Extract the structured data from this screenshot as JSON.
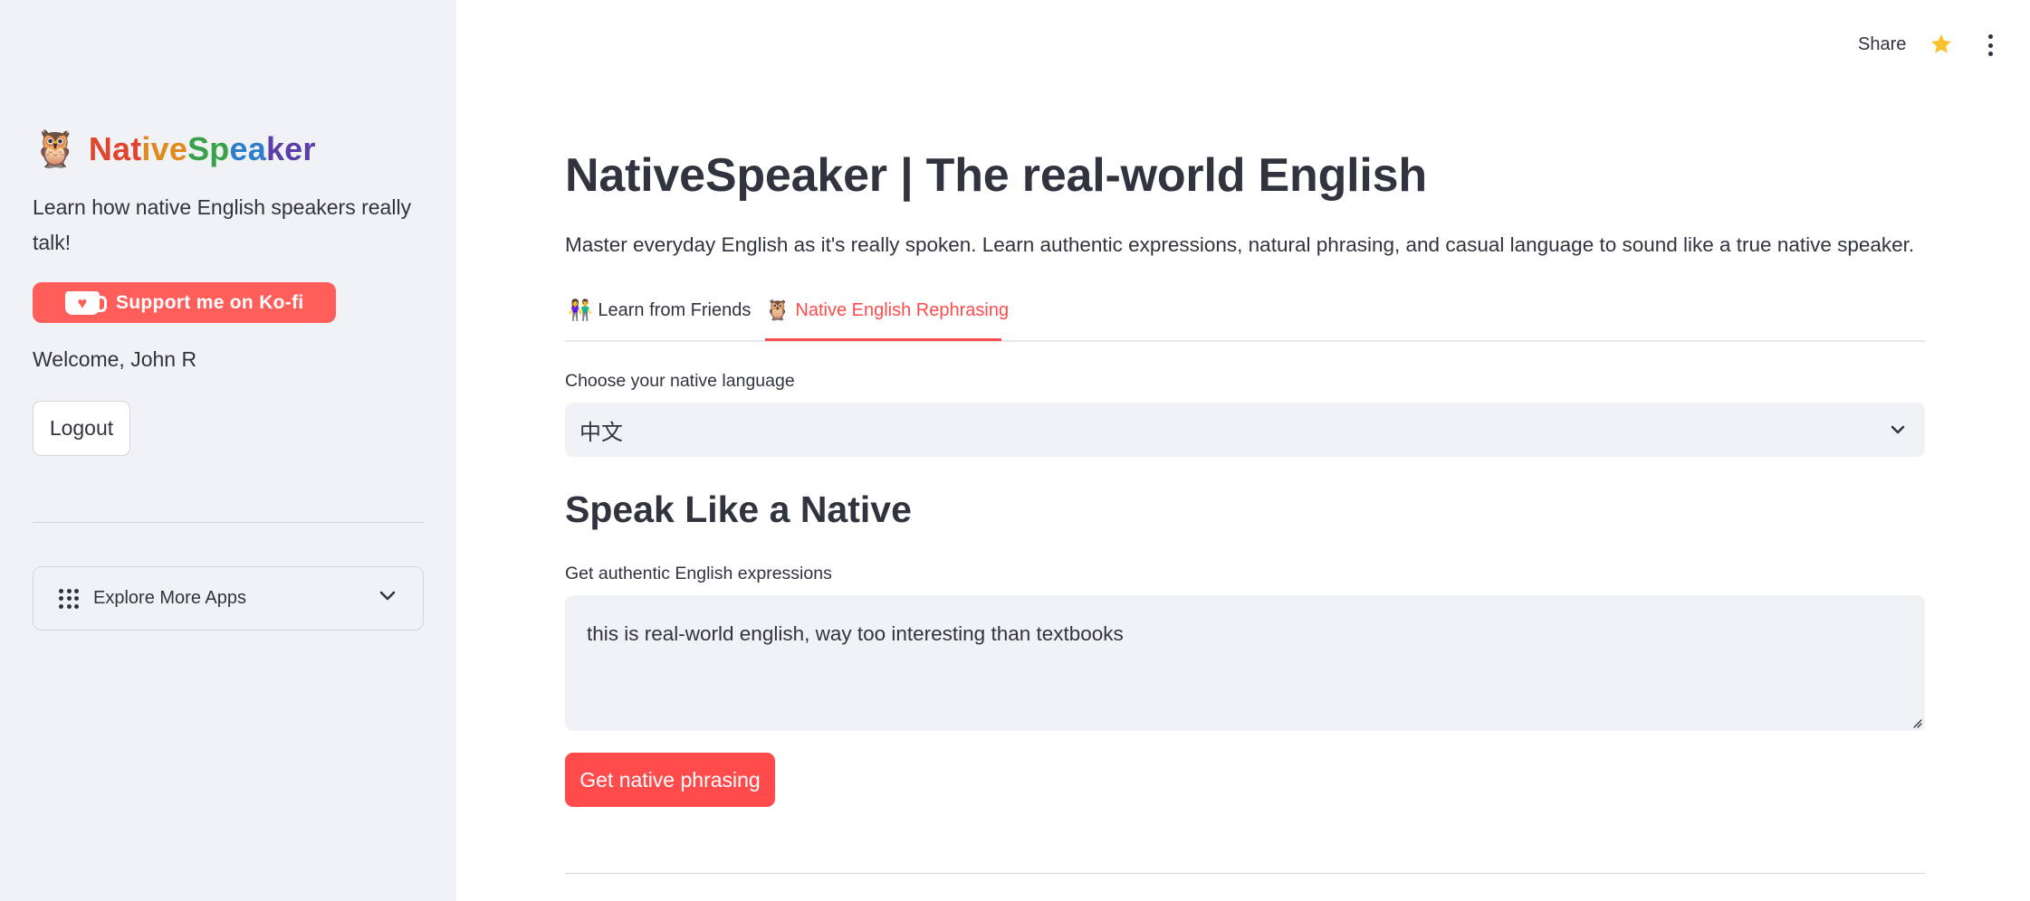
{
  "header": {
    "share_label": "Share",
    "star_icon": "star-icon",
    "menu_icon": "vertical-dots-icon"
  },
  "sidebar": {
    "brand_emoji": "🦉",
    "brand_parts": [
      {
        "text": "Nat",
        "color": "#e0452e"
      },
      {
        "text": "ive",
        "color": "#e08a1e"
      },
      {
        "text": "Sp",
        "color": "#3aa04a"
      },
      {
        "text": "ea",
        "color": "#2f7ec9"
      },
      {
        "text": "ker",
        "color": "#5b3ea8"
      }
    ],
    "tagline": "Learn how native English speakers really talk!",
    "kofi_label": "Support me on Ko-fi",
    "welcome": "Welcome, John R",
    "logout_label": "Logout",
    "explore_label": "Explore More Apps"
  },
  "main": {
    "title": "NativeSpeaker | The real-world English",
    "subtitle": "Master everyday English as it's really spoken. Learn authentic expressions, natural phrasing, and casual language to sound like a true native speaker.",
    "tabs": [
      {
        "emoji": "👫",
        "label": "Learn from Friends",
        "active": false
      },
      {
        "emoji": "🦉",
        "label": "Native English Rephrasing",
        "active": true
      }
    ],
    "language_label": "Choose your native language",
    "language_value": "中文",
    "section_title": "Speak Like a Native",
    "textarea_label": "Get authentic English expressions",
    "textarea_value": "this is real-world english, way too interesting than textbooks",
    "submit_label": "Get native phrasing"
  },
  "colors": {
    "accent": "#ff4b4b",
    "kofi": "#ff5e5b",
    "sidebar_bg": "#f0f2f6",
    "text": "#31333f"
  }
}
